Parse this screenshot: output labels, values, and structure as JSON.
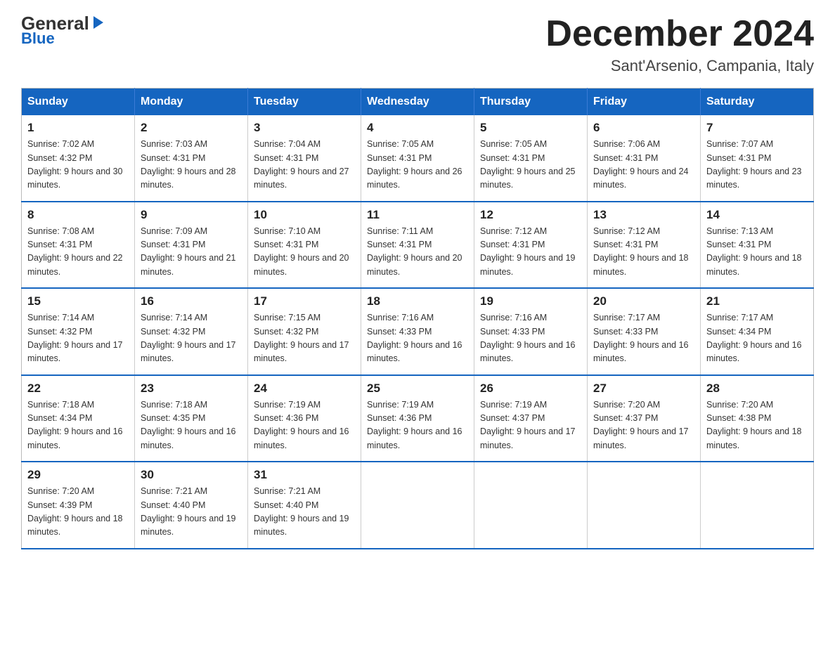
{
  "header": {
    "logo_general": "General",
    "logo_blue": "Blue",
    "month": "December 2024",
    "location": "Sant'Arsenio, Campania, Italy"
  },
  "days_of_week": [
    "Sunday",
    "Monday",
    "Tuesday",
    "Wednesday",
    "Thursday",
    "Friday",
    "Saturday"
  ],
  "weeks": [
    [
      {
        "day": "1",
        "sunrise": "7:02 AM",
        "sunset": "4:32 PM",
        "daylight": "9 hours and 30 minutes."
      },
      {
        "day": "2",
        "sunrise": "7:03 AM",
        "sunset": "4:31 PM",
        "daylight": "9 hours and 28 minutes."
      },
      {
        "day": "3",
        "sunrise": "7:04 AM",
        "sunset": "4:31 PM",
        "daylight": "9 hours and 27 minutes."
      },
      {
        "day": "4",
        "sunrise": "7:05 AM",
        "sunset": "4:31 PM",
        "daylight": "9 hours and 26 minutes."
      },
      {
        "day": "5",
        "sunrise": "7:05 AM",
        "sunset": "4:31 PM",
        "daylight": "9 hours and 25 minutes."
      },
      {
        "day": "6",
        "sunrise": "7:06 AM",
        "sunset": "4:31 PM",
        "daylight": "9 hours and 24 minutes."
      },
      {
        "day": "7",
        "sunrise": "7:07 AM",
        "sunset": "4:31 PM",
        "daylight": "9 hours and 23 minutes."
      }
    ],
    [
      {
        "day": "8",
        "sunrise": "7:08 AM",
        "sunset": "4:31 PM",
        "daylight": "9 hours and 22 minutes."
      },
      {
        "day": "9",
        "sunrise": "7:09 AM",
        "sunset": "4:31 PM",
        "daylight": "9 hours and 21 minutes."
      },
      {
        "day": "10",
        "sunrise": "7:10 AM",
        "sunset": "4:31 PM",
        "daylight": "9 hours and 20 minutes."
      },
      {
        "day": "11",
        "sunrise": "7:11 AM",
        "sunset": "4:31 PM",
        "daylight": "9 hours and 20 minutes."
      },
      {
        "day": "12",
        "sunrise": "7:12 AM",
        "sunset": "4:31 PM",
        "daylight": "9 hours and 19 minutes."
      },
      {
        "day": "13",
        "sunrise": "7:12 AM",
        "sunset": "4:31 PM",
        "daylight": "9 hours and 18 minutes."
      },
      {
        "day": "14",
        "sunrise": "7:13 AM",
        "sunset": "4:31 PM",
        "daylight": "9 hours and 18 minutes."
      }
    ],
    [
      {
        "day": "15",
        "sunrise": "7:14 AM",
        "sunset": "4:32 PM",
        "daylight": "9 hours and 17 minutes."
      },
      {
        "day": "16",
        "sunrise": "7:14 AM",
        "sunset": "4:32 PM",
        "daylight": "9 hours and 17 minutes."
      },
      {
        "day": "17",
        "sunrise": "7:15 AM",
        "sunset": "4:32 PM",
        "daylight": "9 hours and 17 minutes."
      },
      {
        "day": "18",
        "sunrise": "7:16 AM",
        "sunset": "4:33 PM",
        "daylight": "9 hours and 16 minutes."
      },
      {
        "day": "19",
        "sunrise": "7:16 AM",
        "sunset": "4:33 PM",
        "daylight": "9 hours and 16 minutes."
      },
      {
        "day": "20",
        "sunrise": "7:17 AM",
        "sunset": "4:33 PM",
        "daylight": "9 hours and 16 minutes."
      },
      {
        "day": "21",
        "sunrise": "7:17 AM",
        "sunset": "4:34 PM",
        "daylight": "9 hours and 16 minutes."
      }
    ],
    [
      {
        "day": "22",
        "sunrise": "7:18 AM",
        "sunset": "4:34 PM",
        "daylight": "9 hours and 16 minutes."
      },
      {
        "day": "23",
        "sunrise": "7:18 AM",
        "sunset": "4:35 PM",
        "daylight": "9 hours and 16 minutes."
      },
      {
        "day": "24",
        "sunrise": "7:19 AM",
        "sunset": "4:36 PM",
        "daylight": "9 hours and 16 minutes."
      },
      {
        "day": "25",
        "sunrise": "7:19 AM",
        "sunset": "4:36 PM",
        "daylight": "9 hours and 16 minutes."
      },
      {
        "day": "26",
        "sunrise": "7:19 AM",
        "sunset": "4:37 PM",
        "daylight": "9 hours and 17 minutes."
      },
      {
        "day": "27",
        "sunrise": "7:20 AM",
        "sunset": "4:37 PM",
        "daylight": "9 hours and 17 minutes."
      },
      {
        "day": "28",
        "sunrise": "7:20 AM",
        "sunset": "4:38 PM",
        "daylight": "9 hours and 18 minutes."
      }
    ],
    [
      {
        "day": "29",
        "sunrise": "7:20 AM",
        "sunset": "4:39 PM",
        "daylight": "9 hours and 18 minutes."
      },
      {
        "day": "30",
        "sunrise": "7:21 AM",
        "sunset": "4:40 PM",
        "daylight": "9 hours and 19 minutes."
      },
      {
        "day": "31",
        "sunrise": "7:21 AM",
        "sunset": "4:40 PM",
        "daylight": "9 hours and 19 minutes."
      },
      null,
      null,
      null,
      null
    ]
  ]
}
